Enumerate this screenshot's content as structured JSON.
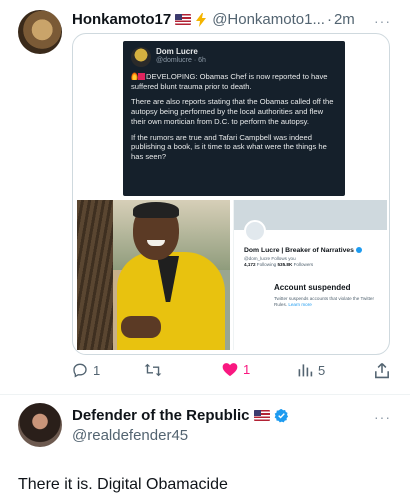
{
  "tweet": {
    "author_name": "Honkamoto17",
    "author_handle": "@Honkamoto1...",
    "separator": "·",
    "time": "2m",
    "more_label": "···",
    "quoted_screenshot": {
      "name": "Dom Lucre",
      "handle": "@domlucre",
      "time": "6h",
      "paragraph1": "DEVELOPING: Obamas Chef is now reported to have suffered blunt trauma prior to death.",
      "paragraph2": "There are also reports stating that the Obamas called off the autopsy being performed by the local authorities and flew their own mortician from D.C. to perform the autopsy.",
      "paragraph3": "If the rumors are true and Tafari Campbell was indeed publishing a book,  is it time to ask what were the things he has seen?"
    },
    "suspended_profile": {
      "name": "Dom Lucre | Breaker of Narratives",
      "handle": "@dom_lucre",
      "follows_you": "Follows you",
      "following_count": "4,172",
      "following_label": "Following",
      "followers_count": "535.8K",
      "followers_label": "Followers",
      "status_title": "Account suspended",
      "status_desc": "Twitter suspends accounts that violate the Twitter Rules.",
      "learn_more": "Learn more"
    },
    "actions": {
      "reply_count": "1",
      "retweet_count": "",
      "like_count": "1",
      "views_count": "5",
      "share_icon": "share-icon"
    },
    "colors": {
      "like": "#f91880",
      "muted": "#536471",
      "verified": "#1d9bf0"
    }
  },
  "reply": {
    "author_name": "Defender of the Republic",
    "author_handle": "@realdefender45",
    "more_label": "···",
    "text": "There it is. Digital Obamacide"
  }
}
